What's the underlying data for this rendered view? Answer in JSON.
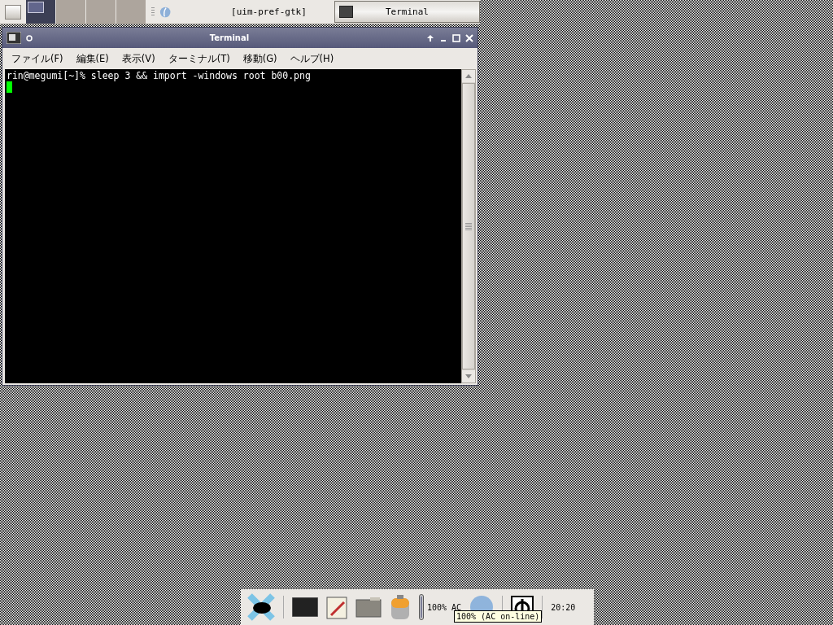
{
  "top_panel": {
    "workspaces": [
      {
        "selected": true
      },
      {
        "selected": false
      },
      {
        "selected": false
      },
      {
        "selected": false
      }
    ],
    "tasks": [
      {
        "label": "[uim-pref-gtk]",
        "selected": false
      },
      {
        "label": "Terminal",
        "selected": true
      }
    ]
  },
  "window": {
    "title": "Terminal",
    "menu": [
      "ファイル(F)",
      "編集(E)",
      "表示(V)",
      "ターミナル(T)",
      "移動(G)",
      "ヘルプ(H)"
    ],
    "terminal": {
      "lines": [
        "rin@megumi[~]% sleep 3 && import -windows root b00.png"
      ]
    }
  },
  "bottom_panel": {
    "battery": {
      "level": 1,
      "reading": "100% AC"
    },
    "tooltip": "100% (AC on-line)",
    "clock": "20:20"
  }
}
